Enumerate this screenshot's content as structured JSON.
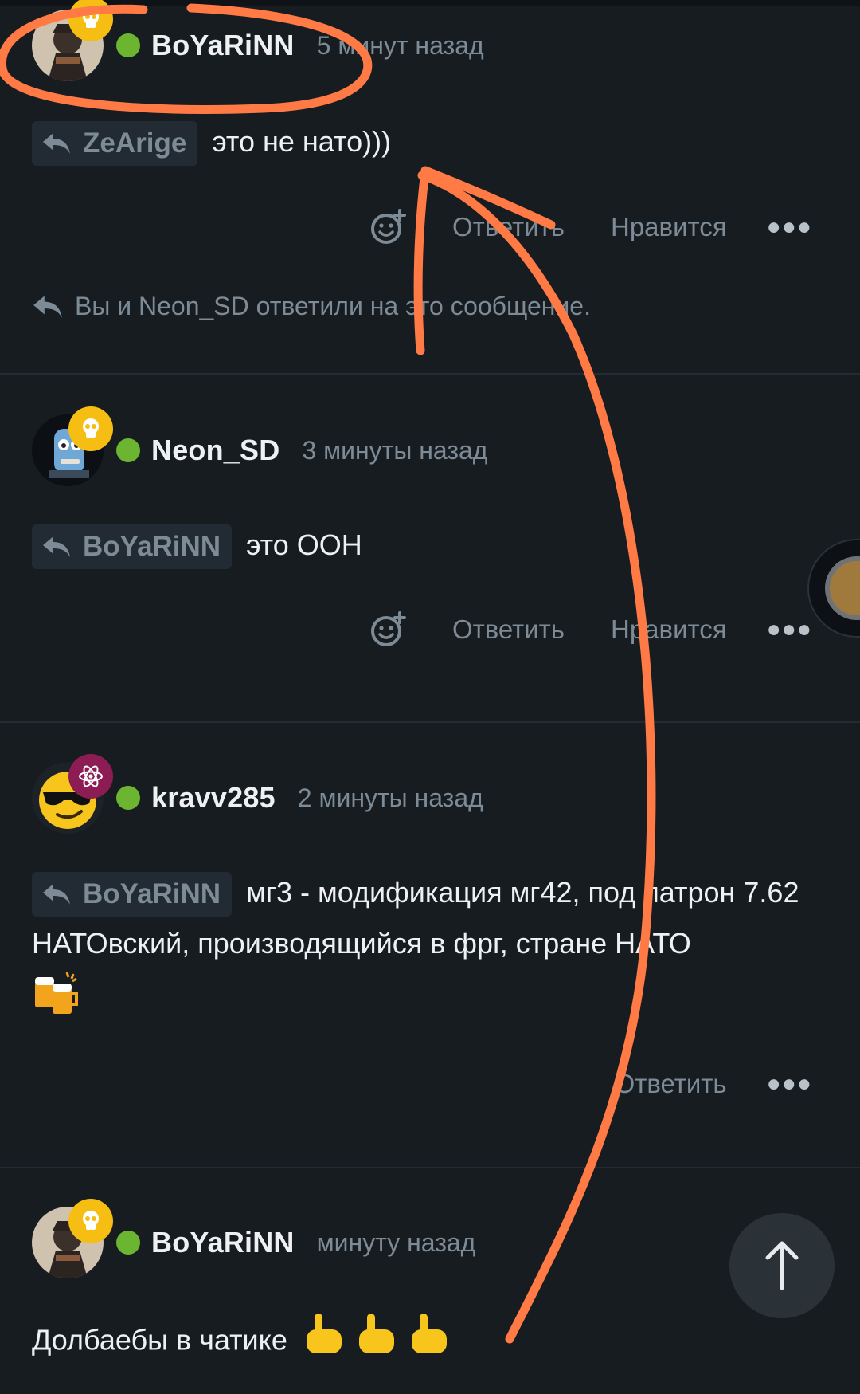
{
  "colors": {
    "background": "#171c21",
    "username": "#eef0f2",
    "muted": "#7d8b96",
    "online": "#6cb531",
    "annotation": "#ff7a45"
  },
  "comments": [
    {
      "user": "BoYaRiNN",
      "time": "5 минут назад",
      "badge": "skull-icon",
      "reply_to": "ZeArige",
      "text": "это не нато)))",
      "actions": {
        "reply": "Ответить",
        "like": "Нравится"
      },
      "replied_note": "Вы и Neon_SD ответили на это сообщение."
    },
    {
      "user": "Neon_SD",
      "time": "3 минуты назад",
      "badge": "skull-icon",
      "reply_to": "BoYaRiNN",
      "text": "это ООН",
      "actions": {
        "reply": "Ответить",
        "like": "Нравится"
      }
    },
    {
      "user": "kravv285",
      "time": "2 минуты назад",
      "badge": "atom-icon",
      "reply_to": "BoYaRiNN",
      "text": "мг3 - модификация мг42, под патрон 7.62 НАТОвский, производящийся в фрг, стране НАТО",
      "actions": {
        "reply": "Ответить"
      }
    },
    {
      "user": "BoYaRiNN",
      "time": "минуту назад",
      "badge": "skull-icon",
      "text": "Долбаебы в чатике"
    }
  ]
}
